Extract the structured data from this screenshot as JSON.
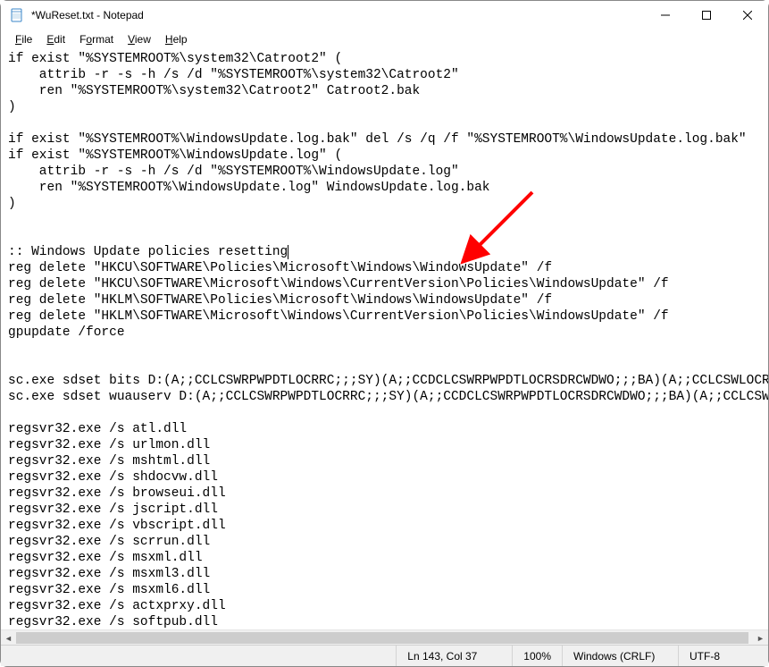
{
  "window": {
    "title": "*WuReset.txt - Notepad"
  },
  "menu": {
    "file": "File",
    "edit": "Edit",
    "format": "Format",
    "view": "View",
    "help": "Help"
  },
  "editor": {
    "lines": [
      "if exist \"%SYSTEMROOT%\\system32\\Catroot2\" (",
      "    attrib -r -s -h /s /d \"%SYSTEMROOT%\\system32\\Catroot2\"",
      "    ren \"%SYSTEMROOT%\\system32\\Catroot2\" Catroot2.bak",
      ")",
      "",
      "if exist \"%SYSTEMROOT%\\WindowsUpdate.log.bak\" del /s /q /f \"%SYSTEMROOT%\\WindowsUpdate.log.bak\"",
      "if exist \"%SYSTEMROOT%\\WindowsUpdate.log\" (",
      "    attrib -r -s -h /s /d \"%SYSTEMROOT%\\WindowsUpdate.log\"",
      "    ren \"%SYSTEMROOT%\\WindowsUpdate.log\" WindowsUpdate.log.bak",
      ")",
      "",
      "",
      ":: Windows Update policies resetting",
      "reg delete \"HKCU\\SOFTWARE\\Policies\\Microsoft\\Windows\\WindowsUpdate\" /f",
      "reg delete \"HKCU\\SOFTWARE\\Microsoft\\Windows\\CurrentVersion\\Policies\\WindowsUpdate\" /f",
      "reg delete \"HKLM\\SOFTWARE\\Policies\\Microsoft\\Windows\\WindowsUpdate\" /f",
      "reg delete \"HKLM\\SOFTWARE\\Microsoft\\Windows\\CurrentVersion\\Policies\\WindowsUpdate\" /f",
      "gpupdate /force",
      "",
      "",
      "sc.exe sdset bits D:(A;;CCLCSWRPWPDTLOCRRC;;;SY)(A;;CCDCLCSWRPWPDTLOCRSDRCWDWO;;;BA)(A;;CCLCSWLOCRRC;;;AU",
      "sc.exe sdset wuauserv D:(A;;CCLCSWRPWPDTLOCRRC;;;SY)(A;;CCDCLCSWRPWPDTLOCRSDRCWDWO;;;BA)(A;;CCLCSWLOCRRC",
      "",
      "regsvr32.exe /s atl.dll",
      "regsvr32.exe /s urlmon.dll",
      "regsvr32.exe /s mshtml.dll",
      "regsvr32.exe /s shdocvw.dll",
      "regsvr32.exe /s browseui.dll",
      "regsvr32.exe /s jscript.dll",
      "regsvr32.exe /s vbscript.dll",
      "regsvr32.exe /s scrrun.dll",
      "regsvr32.exe /s msxml.dll",
      "regsvr32.exe /s msxml3.dll",
      "regsvr32.exe /s msxml6.dll",
      "regsvr32.exe /s actxprxy.dll",
      "regsvr32.exe /s softpub.dll"
    ],
    "cursor_line_index": 12
  },
  "statusbar": {
    "position": "Ln 143, Col 37",
    "zoom": "100%",
    "line_ending": "Windows (CRLF)",
    "encoding": "UTF-8"
  },
  "annotation": {
    "arrow_target": "red-arrow"
  }
}
